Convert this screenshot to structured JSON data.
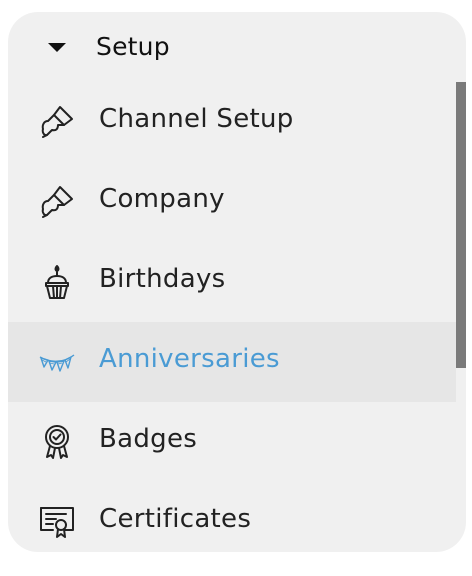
{
  "menu": {
    "header": {
      "label": "Setup",
      "icon": "caret-down-icon"
    },
    "items": [
      {
        "label": "Channel Setup",
        "icon": "paintbrush-icon"
      },
      {
        "label": "Company",
        "icon": "paintbrush-icon"
      },
      {
        "label": "Birthdays",
        "icon": "cupcake-icon"
      },
      {
        "label": "Anniversaries",
        "icon": "bunting-flags-icon",
        "active": true
      },
      {
        "label": "Badges",
        "icon": "badge-ribbon-icon"
      },
      {
        "label": "Certificates",
        "icon": "certificate-icon"
      }
    ]
  },
  "colors": {
    "active_text": "#4a9bd4",
    "active_bg": "#e6e6e6",
    "panel_bg": "#f0f0f0"
  }
}
